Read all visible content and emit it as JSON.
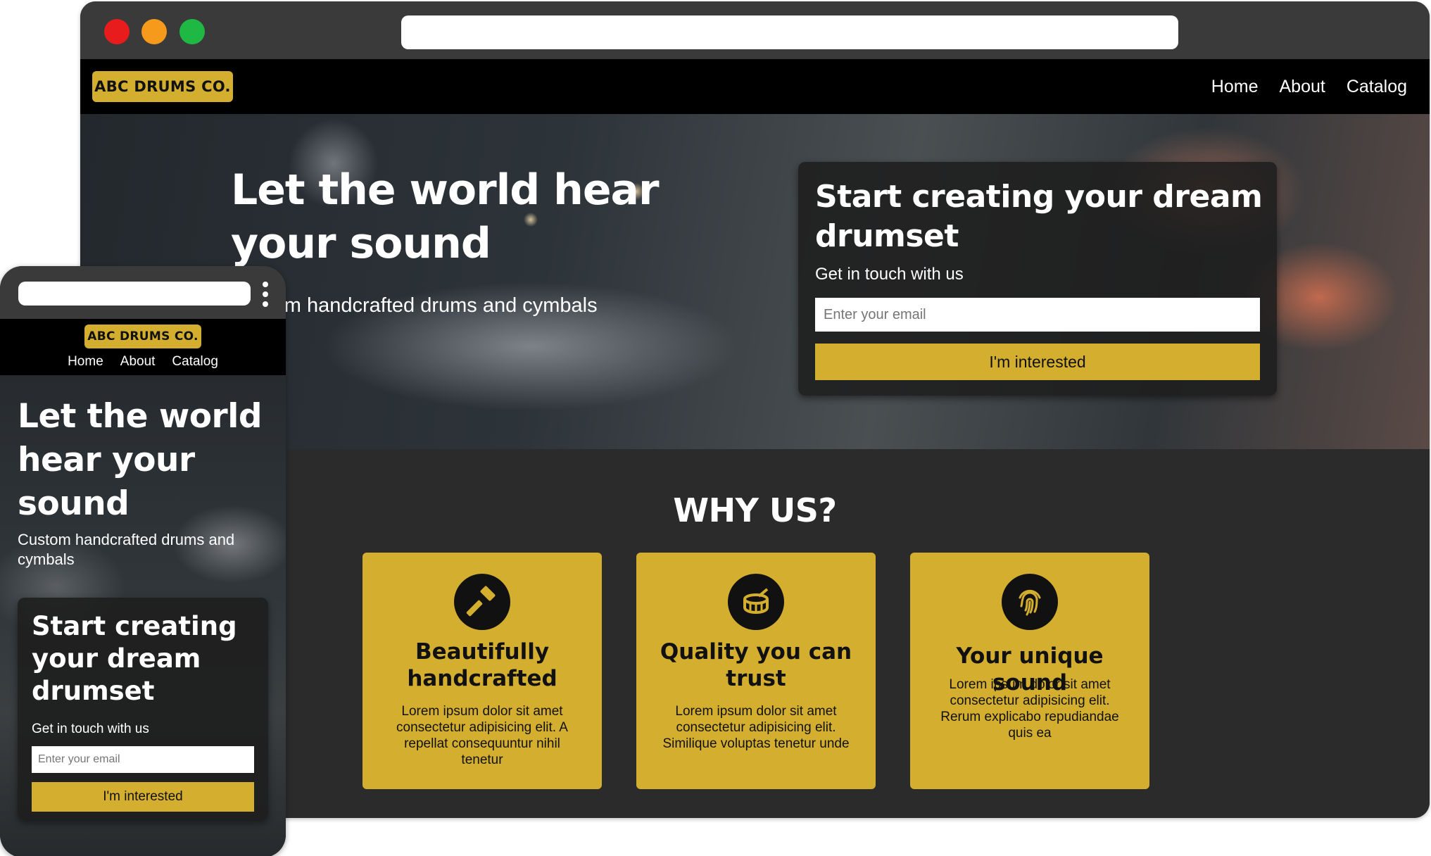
{
  "brand": {
    "logo_text": "ABC DRUMS CO.",
    "accent_color": "#d4af2f"
  },
  "desktop": {
    "nav": {
      "links": [
        "Home",
        "About",
        "Catalog"
      ]
    },
    "hero": {
      "title": "Let the world hear your sound",
      "subtitle": "Custom handcrafted drums and cymbals"
    },
    "form": {
      "title": "Start creating your dream drumset",
      "subtitle": "Get in touch with us",
      "email_placeholder": "Enter your email",
      "button_label": "I'm interested"
    },
    "why": {
      "title": "WHY US?",
      "cards": [
        {
          "icon": "hammer-icon",
          "title": "Beautifully handcrafted",
          "body": "Lorem ipsum dolor sit amet consectetur adipisicing elit. A repellat consequuntur nihil tenetur"
        },
        {
          "icon": "drum-icon",
          "title": "Quality you can trust",
          "body": "Lorem ipsum dolor sit amet consectetur adipisicing elit. Similique voluptas tenetur unde"
        },
        {
          "icon": "fingerprint-icon",
          "title": "Your unique sound",
          "body": "Lorem ipsum dolor sit amet consectetur adipisicing elit. Rerum explicabo repudiandae quis ea"
        }
      ]
    }
  },
  "mobile": {
    "nav": {
      "links": [
        "Home",
        "About",
        "Catalog"
      ]
    },
    "hero": {
      "title": "Let the world hear your sound",
      "subtitle": "Custom handcrafted drums and cymbals"
    },
    "form": {
      "title": "Start creating your dream drumset",
      "subtitle": "Get in touch with us",
      "email_placeholder": "Enter your email",
      "button_label": "I'm interested"
    }
  }
}
